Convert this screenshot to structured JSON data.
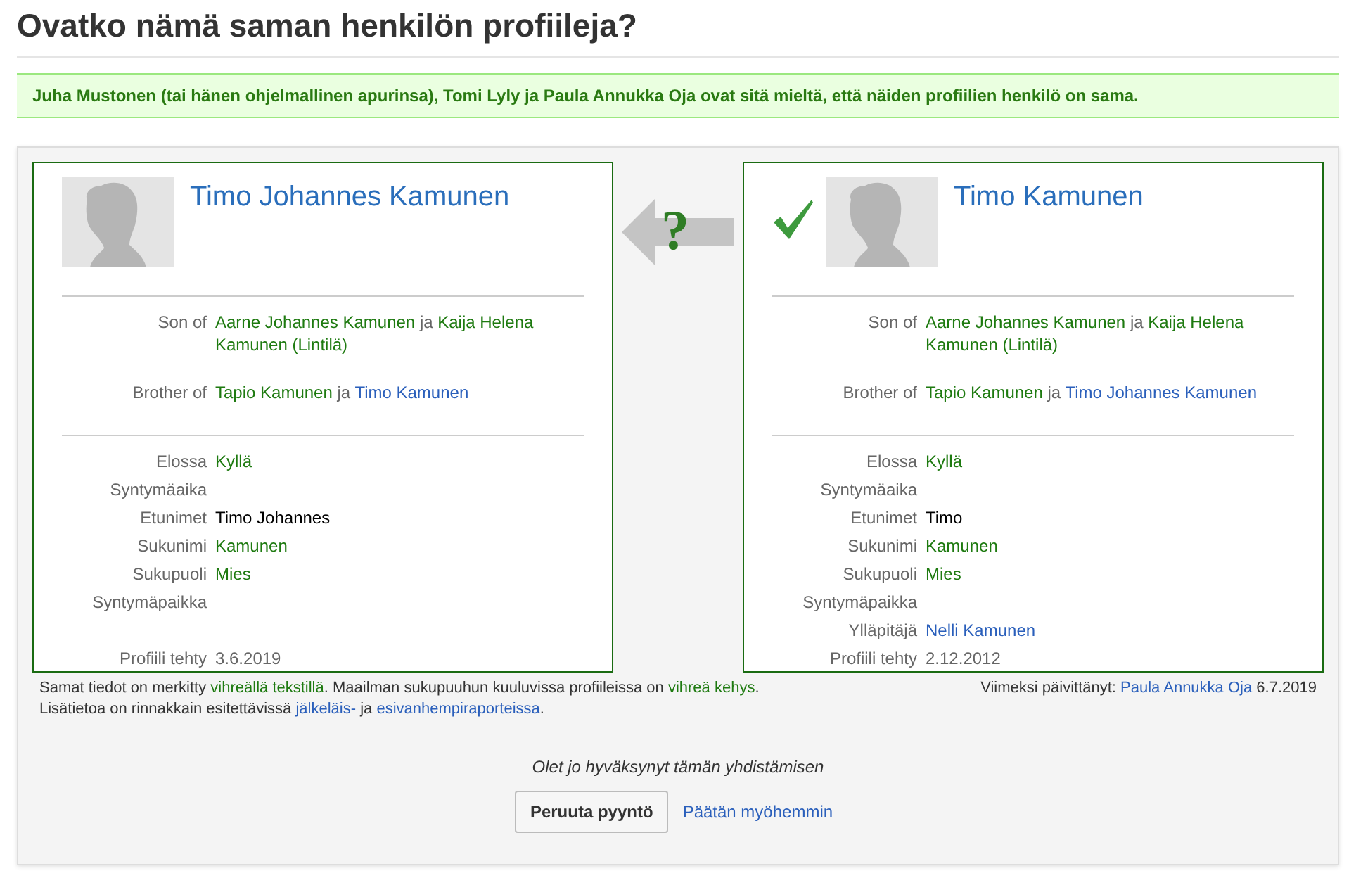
{
  "title": "Ovatko nämä saman henkilön profiileja?",
  "banner": "Juha Mustonen (tai hänen ohjelmallinen apurinsa), Tomi Lyly ja Paula Annukka Oja ovat sitä mieltä, että näiden profiilien henkilö on sama.",
  "compare_mark": "?",
  "profiles": [
    {
      "name": "Timo Johannes Kamunen",
      "confirmed": false,
      "in_world_tree": true,
      "relations": [
        {
          "label": "Son of",
          "value": [
            {
              "text": "Aarne Johannes Kamunen",
              "kind": "match"
            },
            {
              "text": " ja ",
              "kind": "text"
            },
            {
              "text": "Kaija Helena Kamunen (Lintilä)",
              "kind": "match"
            }
          ]
        },
        {
          "label": "Brother of",
          "value": [
            {
              "text": "Tapio Kamunen",
              "kind": "match"
            },
            {
              "text": " ja ",
              "kind": "text"
            },
            {
              "text": "Timo Kamunen",
              "kind": "link"
            }
          ]
        }
      ],
      "facts": [
        {
          "label": "Elossa",
          "value": [
            {
              "text": "Kyllä",
              "kind": "match"
            }
          ]
        },
        {
          "label": "Syntymäaika"
        },
        {
          "label": "Etunimet",
          "value": [
            {
              "text": "Timo Johannes",
              "kind": "differ"
            }
          ]
        },
        {
          "label": "Sukunimi",
          "value": [
            {
              "text": "Kamunen",
              "kind": "match"
            }
          ]
        },
        {
          "label": "Sukupuoli",
          "value": [
            {
              "text": "Mies",
              "kind": "match"
            }
          ]
        },
        {
          "label": "Syntymäpaikka"
        },
        {
          "label": "Profiili tehty",
          "value": [
            {
              "text": "3.6.2019",
              "kind": "text"
            }
          ]
        }
      ]
    },
    {
      "name": "Timo Kamunen",
      "confirmed": true,
      "in_world_tree": true,
      "relations": [
        {
          "label": "Son of",
          "value": [
            {
              "text": "Aarne Johannes Kamunen",
              "kind": "match"
            },
            {
              "text": " ja ",
              "kind": "text"
            },
            {
              "text": "Kaija Helena Kamunen (Lintilä)",
              "kind": "match"
            }
          ]
        },
        {
          "label": "Brother of",
          "value": [
            {
              "text": "Tapio Kamunen",
              "kind": "match"
            },
            {
              "text": " ja ",
              "kind": "text"
            },
            {
              "text": "Timo Johannes Kamunen",
              "kind": "link"
            }
          ]
        }
      ],
      "facts": [
        {
          "label": "Elossa",
          "value": [
            {
              "text": "Kyllä",
              "kind": "match"
            }
          ]
        },
        {
          "label": "Syntymäaika"
        },
        {
          "label": "Etunimet",
          "value": [
            {
              "text": "Timo",
              "kind": "differ"
            }
          ]
        },
        {
          "label": "Sukunimi",
          "value": [
            {
              "text": "Kamunen",
              "kind": "match"
            }
          ]
        },
        {
          "label": "Sukupuoli",
          "value": [
            {
              "text": "Mies",
              "kind": "match"
            }
          ]
        },
        {
          "label": "Syntymäpaikka"
        },
        {
          "label": "Ylläpitäjä",
          "value": [
            {
              "text": "Nelli Kamunen",
              "kind": "link"
            }
          ]
        },
        {
          "label": "Profiili tehty",
          "value": [
            {
              "text": "2.12.2012",
              "kind": "text"
            }
          ]
        }
      ]
    }
  ],
  "legend": [
    [
      {
        "text": "Samat tiedot on merkitty ",
        "kind": "text"
      },
      {
        "text": "vihreällä tekstillä",
        "kind": "match"
      },
      {
        "text": ". Maailman sukupuuhun kuuluvissa profiileissa on ",
        "kind": "text"
      },
      {
        "text": "vihreä kehys",
        "kind": "match"
      },
      {
        "text": ".",
        "kind": "text"
      }
    ],
    [
      {
        "text": "Lisätietoa on rinnakkain esitettävissä ",
        "kind": "text"
      },
      {
        "text": "jälkeläis-",
        "kind": "link"
      },
      {
        "text": " ja ",
        "kind": "text"
      },
      {
        "text": "esivanhempiraporteissa",
        "kind": "link"
      },
      {
        "text": ".",
        "kind": "text"
      }
    ]
  ],
  "updated": {
    "label": "Viimeksi päivittänyt:",
    "user": "Paula Annukka Oja",
    "date": "6.7.2019"
  },
  "status": "Olet jo hyväksynyt tämän yhdistämisen",
  "buttons": [
    {
      "label": "Peruuta pyyntö",
      "kind": "button"
    },
    {
      "label": "Päätän myöhemmin",
      "kind": "link"
    }
  ]
}
